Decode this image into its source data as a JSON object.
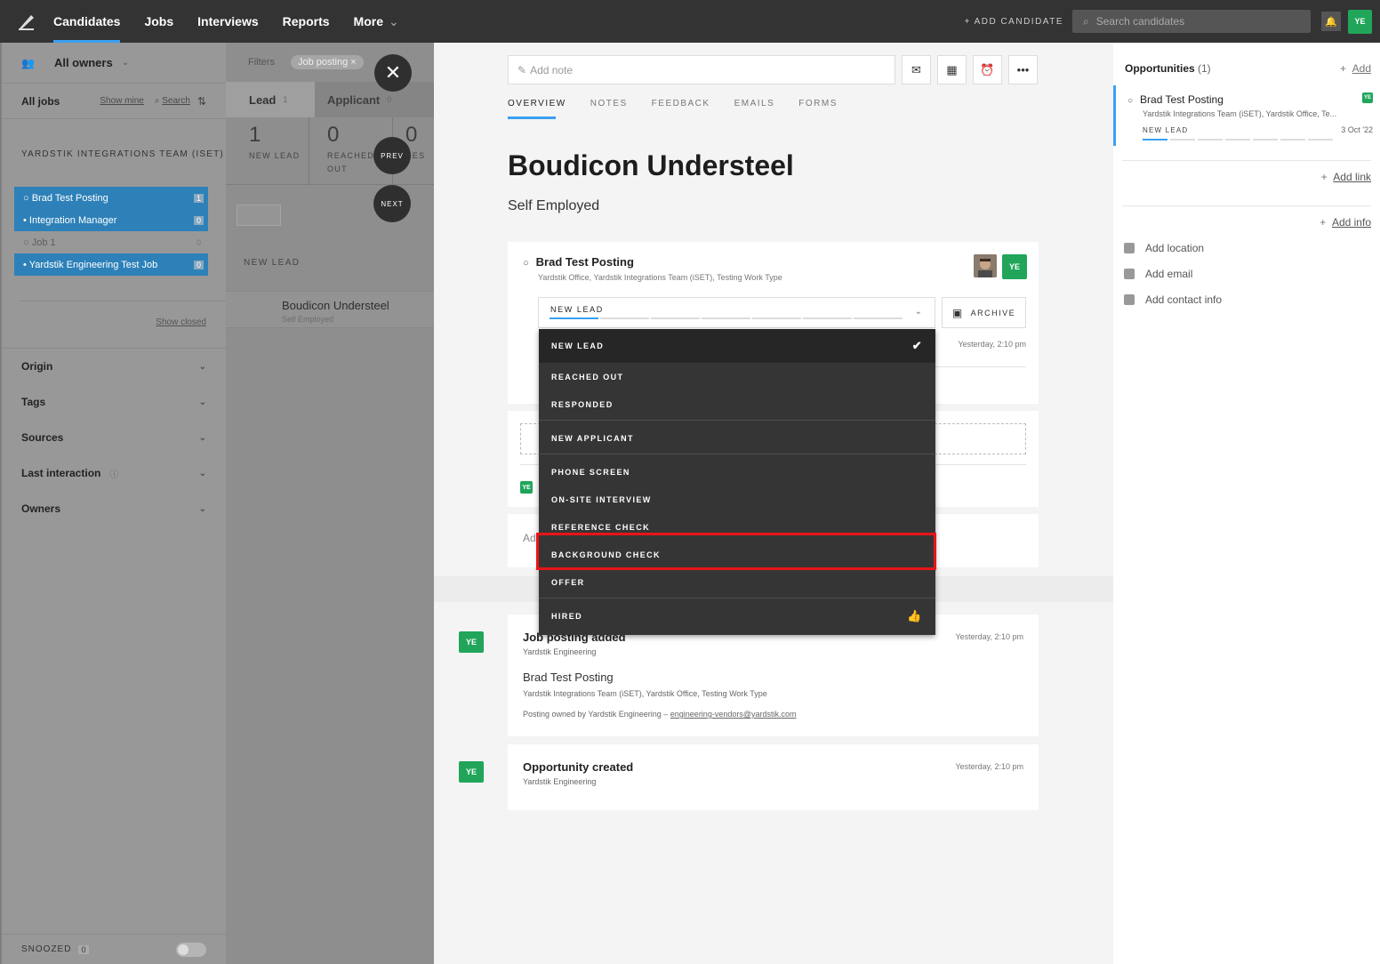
{
  "nav": {
    "items": [
      "Candidates",
      "Jobs",
      "Interviews",
      "Reports",
      "More"
    ],
    "more_caret": "⌄",
    "add_candidate": "+ ADD CANDIDATE",
    "search_placeholder": "Search candidates",
    "user_initials": "YE"
  },
  "sidebar": {
    "owners": "All owners",
    "all_jobs": "All jobs",
    "show_mine": "Show mine",
    "search": "Search",
    "team": "YARDSTIK INTEGRATIONS TEAM (ISET)",
    "jobs": [
      {
        "label": "○ Brad Test Posting",
        "count": "1"
      },
      {
        "label": "• Integration Manager",
        "count": "0"
      },
      {
        "label": "○ Job 1",
        "count": "0"
      },
      {
        "label": "• Yardstik Engineering Test Job",
        "count": "0"
      }
    ],
    "show_closed": "Show closed",
    "filters": [
      "Origin",
      "Tags",
      "Sources",
      "Last interaction",
      "Owners"
    ],
    "snoozed": "SNOOZED",
    "snoozed_count": "0"
  },
  "pipeline": {
    "filters_label": "Filters",
    "chip": "Job posting ×",
    "tabs": [
      {
        "label": "Lead",
        "count": "1"
      },
      {
        "label": "Applicant",
        "count": "0"
      }
    ],
    "counts": [
      {
        "n": "1",
        "label": "NEW LEAD"
      },
      {
        "n": "0",
        "label": "REACHED OUT"
      },
      {
        "n": "0",
        "label": "RES"
      }
    ],
    "prev": "PREV",
    "next": "NEXT",
    "section": "NEW LEAD",
    "candidate_name": "Boudicon Understeel",
    "candidate_sub": "Self Employed"
  },
  "profile": {
    "note_placeholder": "Add note",
    "tabs": [
      "OVERVIEW",
      "NOTES",
      "FEEDBACK",
      "EMAILS",
      "FORMS"
    ],
    "name": "Boudicon Understeel",
    "org": "Self Employed",
    "opportunity": {
      "title": "Brad Test Posting",
      "sub": "Yardstik Office, Yardstik Integrations Team (iSET), Testing Work Type",
      "stage": "NEW LEAD",
      "archive": "ARCHIVE",
      "time": "Yesterday, 2:10 pm",
      "owner_initials": "YE"
    },
    "add_prefix": "Ad",
    "activity": [
      {
        "title": "Job posting added",
        "by": "Yardstik Engineering",
        "time": "Yesterday, 2:10 pm",
        "job": "Brad Test Posting",
        "team": "Yardstik Integrations Team (iSET), Yardstik Office, Testing Work Type",
        "owned_prefix": "Posting owned by Yardstik Engineering – ",
        "owned_email": "engineering-vendors@yardstik.com"
      },
      {
        "title": "Opportunity created",
        "by": "Yardstik Engineering",
        "time": "Yesterday, 2:10 pm"
      }
    ]
  },
  "dropdown": {
    "items": [
      "NEW LEAD",
      "REACHED OUT",
      "RESPONDED",
      "NEW APPLICANT",
      "PHONE SCREEN",
      "ON-SITE INTERVIEW",
      "REFERENCE CHECK",
      "BACKGROUND CHECK",
      "OFFER",
      "HIRED"
    ],
    "selected": "NEW LEAD",
    "highlighted": "BACKGROUND CHECK"
  },
  "right": {
    "opps_label": "Opportunities",
    "opps_count": "(1)",
    "add": "Add",
    "opp_title": "Brad Test Posting",
    "opp_sub": "Yardstik Integrations Team (iSET), Yardstik Office, Te...",
    "opp_stage": "NEW LEAD",
    "opp_date": "3 Oct '22",
    "add_link": "Add link",
    "add_info": "Add info",
    "info": [
      "Add location",
      "Add email",
      "Add contact info"
    ]
  },
  "colors": {
    "accent": "#3b9ff3",
    "green": "#20a55a",
    "highlight": "#e8141a"
  }
}
